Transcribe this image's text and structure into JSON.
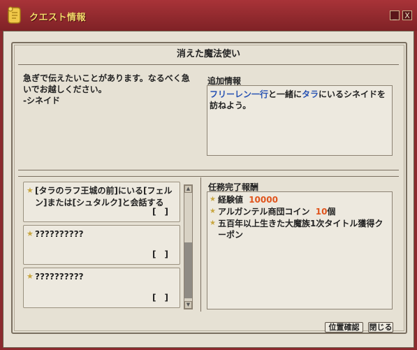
{
  "window": {
    "title": "クエスト情報",
    "minimize_label": "_",
    "close_label": "X"
  },
  "quest": {
    "name": "消えた魔法使い",
    "message": "急ぎで伝えたいことがあります。なるべく急いでお越しください。\n-シネイド"
  },
  "additional_info": {
    "label": "追加情報",
    "segments": [
      {
        "text": "フリーレン一行",
        "highlight": true
      },
      {
        "text": "と一緒に",
        "highlight": false
      },
      {
        "text": "タラ",
        "highlight": true
      },
      {
        "text": "にいるシネイドを訪ねよう。",
        "highlight": false
      }
    ]
  },
  "objectives": [
    {
      "text": "[タラのラフ王城の前]にいる[フェルン]または[シュタルク]と会話する",
      "status": "[　]"
    },
    {
      "text": "??????????",
      "status": "[　]"
    },
    {
      "text": "??????????",
      "status": "[　]"
    }
  ],
  "rewards": {
    "label": "任務完了報酬",
    "items": [
      {
        "prefix": "経験値",
        "value": "10000",
        "suffix": ""
      },
      {
        "prefix": "アルガンテル商団コイン",
        "value": "10",
        "suffix": "個"
      },
      {
        "prefix": "五百年以上生きた大魔族1次タイトル獲得クーポン",
        "value": "",
        "suffix": ""
      }
    ]
  },
  "buttons": {
    "locate": "位置確認",
    "close": "閉じる"
  },
  "colors": {
    "title_bar": "#8b2a2e",
    "title_text": "#f2d86a",
    "highlight_blue": "#2752b3",
    "value_orange": "#e0541c",
    "panel_bg": "#e6e1d4"
  }
}
